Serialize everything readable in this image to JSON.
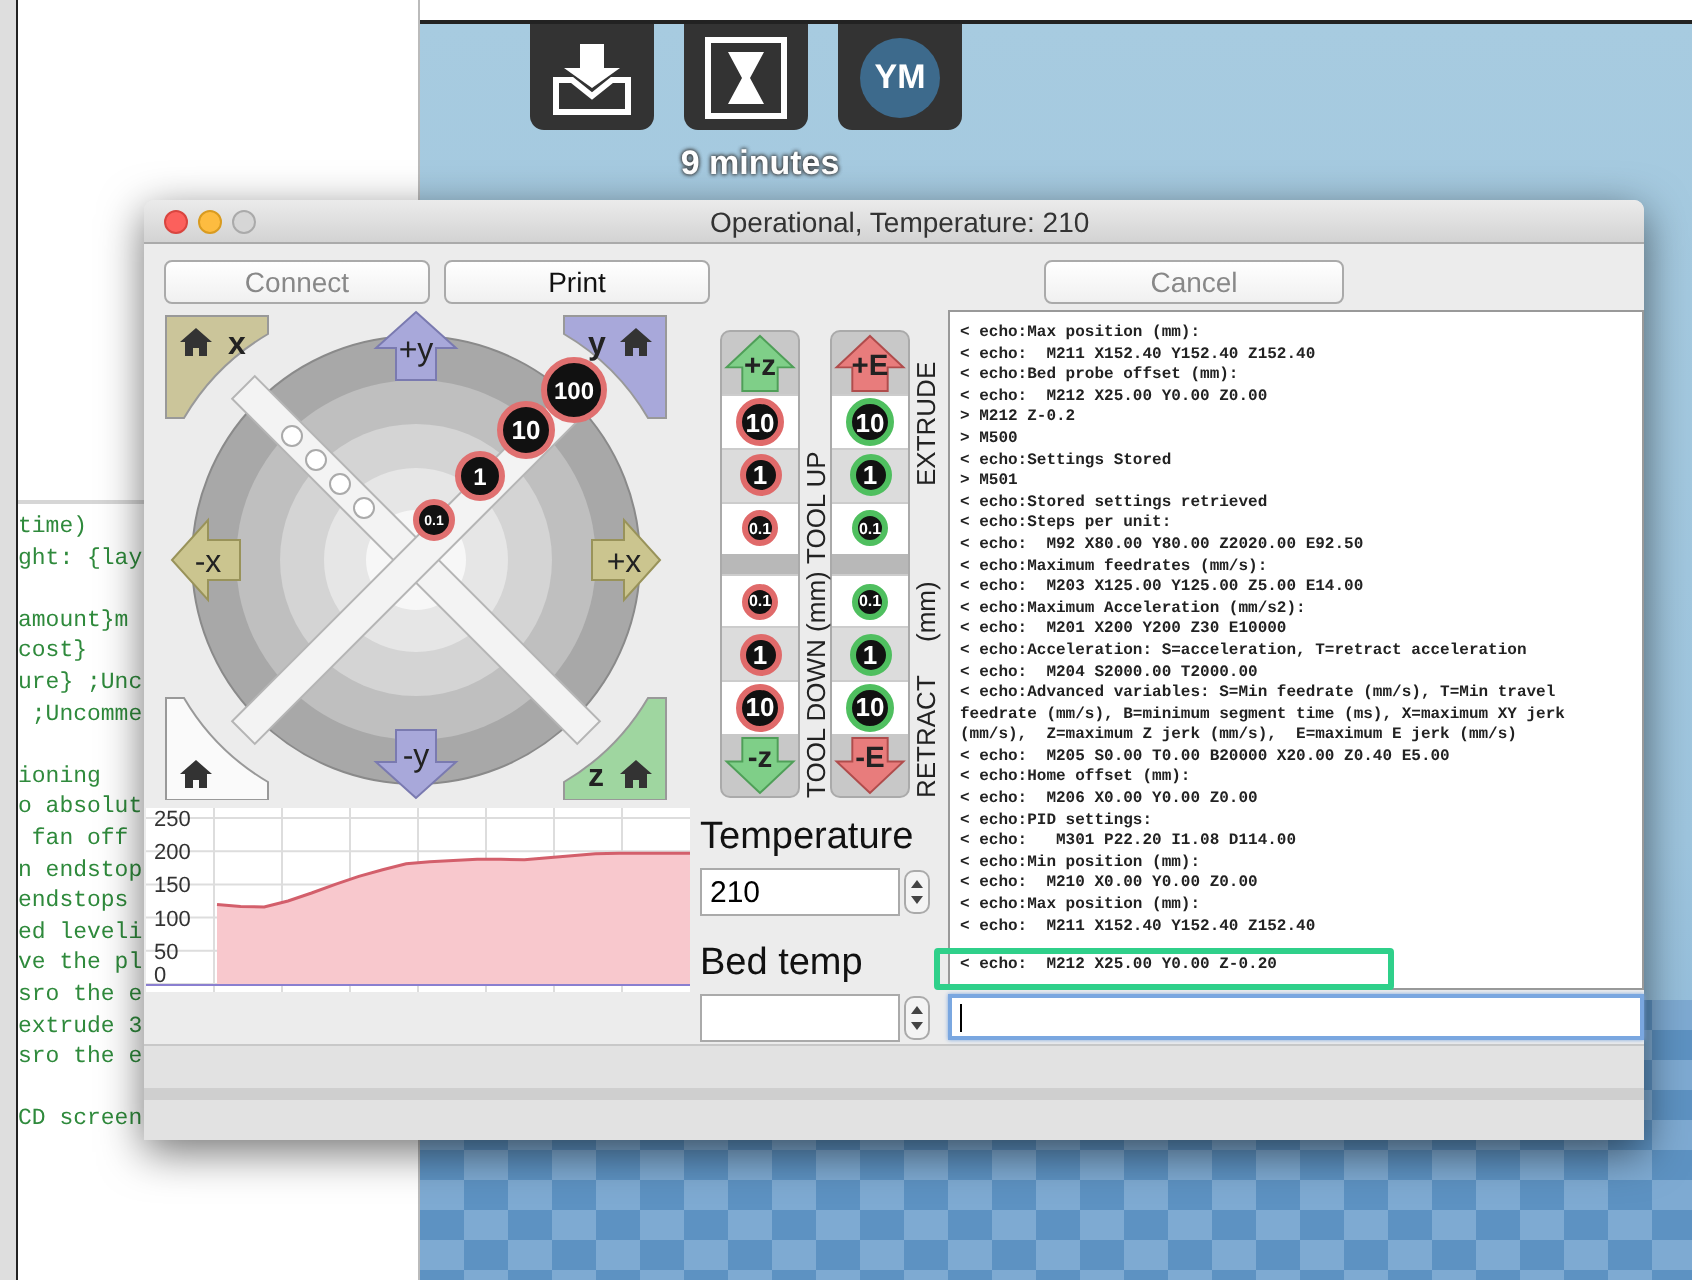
{
  "editor": {
    "blocks": [
      [
        "time)",
        "ght: {lay"
      ],
      [
        "amount}m",
        "cost}",
        "ure} ;Unc",
        " ;Uncomme"
      ],
      [
        "ioning",
        "o absolut",
        " fan off",
        "n endstop",
        "endstops",
        "ed leveli",
        "ve the pl",
        "sro the e",
        "extrude 3",
        "sro the e"
      ],
      [
        "CD screen"
      ]
    ]
  },
  "preview": {
    "tools": [
      {
        "kind": "tray"
      },
      {
        "kind": "hourglass"
      },
      {
        "kind": "profile",
        "text": "YM"
      }
    ],
    "estimate": "9 minutes"
  },
  "window": {
    "title": "Operational, Temperature: 210",
    "buttons": [
      {
        "label": "Connect",
        "disabled": true
      },
      {
        "label": "Print",
        "disabled": false
      },
      {
        "label": "Cancel",
        "disabled": true
      }
    ]
  },
  "jog": {
    "corners": [
      {
        "kind": "northwest",
        "label": "x"
      },
      {
        "kind": "northeast",
        "label": "y"
      },
      {
        "kind": "southwest"
      },
      {
        "kind": "southeast",
        "label": "z"
      }
    ],
    "arrows": [
      {
        "kind": "up",
        "label": "+y"
      },
      {
        "kind": "left",
        "label": "-x"
      },
      {
        "kind": "right",
        "label": "+x"
      },
      {
        "kind": "down",
        "label": "-y"
      }
    ],
    "steps": [
      "100",
      "10",
      "1",
      "0.1"
    ]
  },
  "axes": [
    {
      "kind": "z",
      "up": "+z",
      "down": "-z",
      "steps_up": [
        "10",
        "1",
        "0.1"
      ],
      "steps_down": [
        "0.1",
        "1",
        "10"
      ],
      "labels": [
        "TOOL UP",
        "TOOL DOWN (mm)"
      ]
    },
    {
      "kind": "e",
      "up": "+E",
      "down": "-E",
      "steps_up": [
        "10",
        "1",
        "0.1"
      ],
      "steps_down": [
        "0.1",
        "1",
        "10"
      ],
      "labels": [
        "EXTRUDE",
        "(mm)",
        "RETRACT"
      ]
    }
  ],
  "chart": {
    "chart_data": {
      "type": "area",
      "grid": true,
      "ylim": [
        0,
        250
      ],
      "yticks": [
        {
          "value": 0,
          "label": "0"
        },
        {
          "value": 50,
          "label": "50"
        },
        {
          "value": 100,
          "label": "100"
        },
        {
          "value": 150,
          "label": "150"
        },
        {
          "value": 200,
          "label": "200"
        },
        {
          "value": 250,
          "label": "250"
        }
      ],
      "values": [
        null,
        null,
        null,
        120,
        117,
        116,
        125,
        137,
        150,
        162,
        172,
        181,
        184,
        186,
        188,
        188,
        187,
        190,
        193,
        196,
        197,
        197,
        197,
        197
      ]
    }
  },
  "temperature": {
    "label": "Temperature",
    "value": "210"
  },
  "bed_temp": {
    "label": "Bed temp"
  },
  "console": {
    "lines": [
      "< echo:Max position (mm):",
      "< echo:  M211 X152.40 Y152.40 Z152.40",
      "< echo:Bed probe offset (mm):",
      "< echo:  M212 X25.00 Y0.00 Z0.00",
      "> M212 Z-0.2",
      "> M500",
      "< echo:Settings Stored",
      "> M501",
      "< echo:Stored settings retrieved",
      "< echo:Steps per unit:",
      "< echo:  M92 X80.00 Y80.00 Z2020.00 E92.50",
      "< echo:Maximum feedrates (mm/s):",
      "< echo:  M203 X125.00 Y125.00 Z5.00 E14.00",
      "< echo:Maximum Acceleration (mm/s2):",
      "< echo:  M201 X200 Y200 Z30 E10000",
      "< echo:Acceleration: S=acceleration, T=retract acceleration",
      "< echo:  M204 S2000.00 T2000.00",
      "< echo:Advanced variables: S=Min feedrate (mm/s), T=Min travel",
      "feedrate (mm/s), B=minimum segment time (ms), X=maximum XY jerk",
      "(mm/s),  Z=maximum Z jerk (mm/s),  E=maximum E jerk (mm/s)",
      "< echo:  M205 S0.00 T0.00 B20000 X20.00 Z0.40 E5.00",
      "< echo:Home offset (mm):",
      "< echo:  M206 X0.00 Y0.00 Z0.00",
      "< echo:PID settings:",
      "< echo:   M301 P22.20 I1.08 D114.00",
      "< echo:Min position (mm):",
      "< echo:  M210 X0.00 Y0.00 Z0.00",
      "< echo:Max position (mm):",
      "< echo:  M211 X152.40 Y152.40 Z152.40",
      "< echo:  M212 X25.00 Y0.00 Z-0.20"
    ],
    "highlight_last": true
  },
  "command_input": {
    "focused": true
  }
}
